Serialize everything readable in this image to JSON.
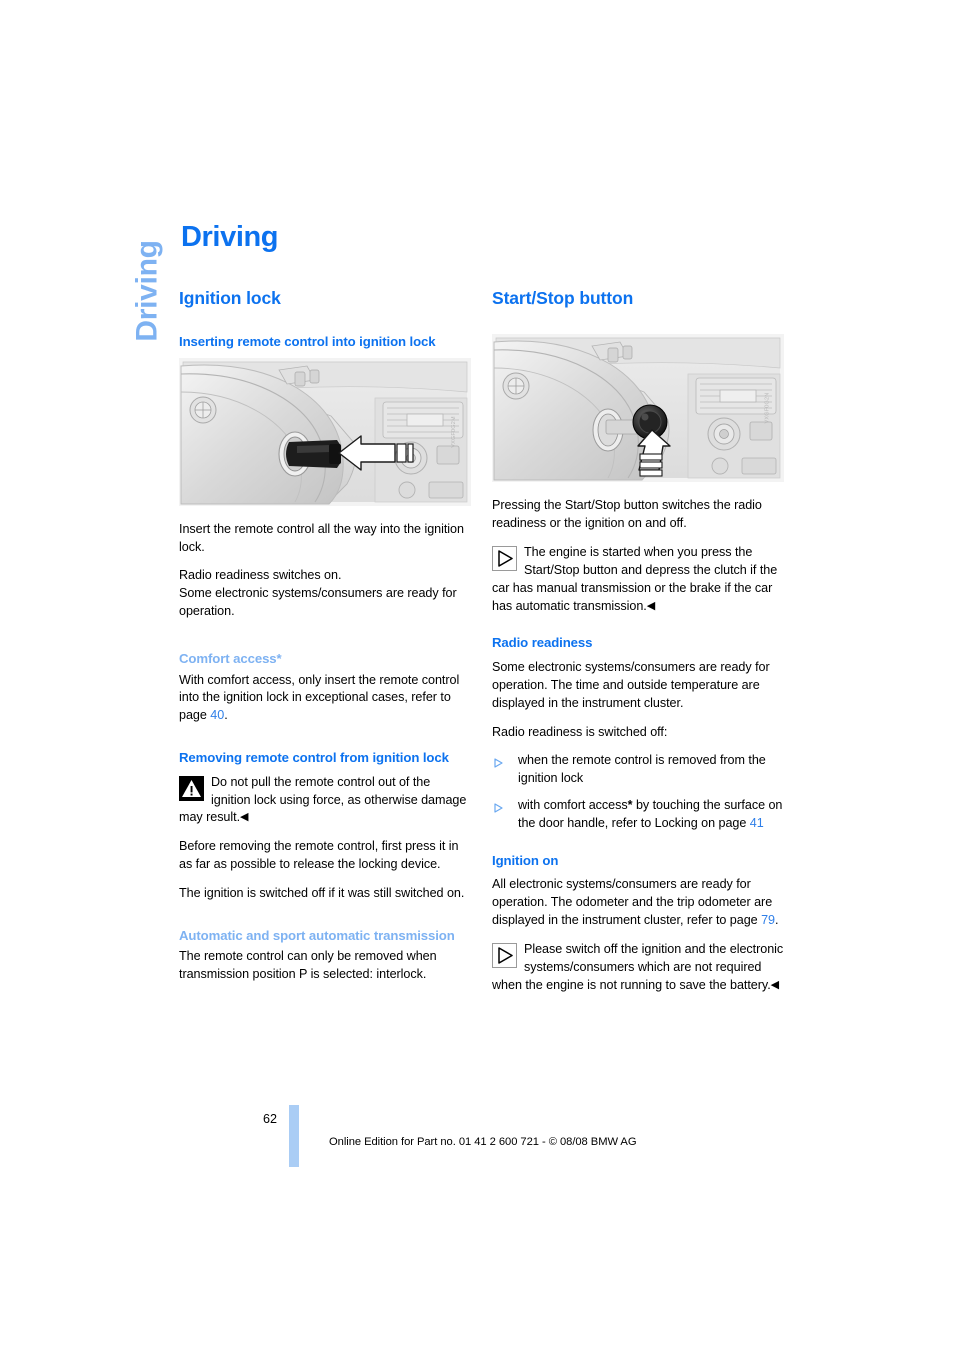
{
  "chapter_tab": {
    "label": "Driving"
  },
  "page_title": "Driving",
  "left_column": {
    "section_heading": "Ignition lock",
    "sub1_heading": "Inserting remote control into ignition lock",
    "figure1": {
      "code": "VXGF0G2M",
      "alt": "Dashboard view showing remote control being inserted into the ignition lock with a white arrow"
    },
    "para1": "Insert the remote control all the way into the ignition lock.",
    "para2_line1": "Radio readiness switches on.",
    "para2_line2": "Some electronic systems/consumers are ready for operation.",
    "comfort_heading": "Comfort access*",
    "comfort_text_a": "With comfort access, only insert the remote control into the ignition lock in exceptional cases, refer to page ",
    "comfort_page_ref": "40",
    "comfort_text_b": ".",
    "removing_heading": "Removing remote control from ignition lock",
    "warning_icon": "warning-triangle-icon",
    "warning_text": "Do not pull the remote control out of the ignition lock using force, as otherwise damage may result.",
    "warning_end_mark": "◀",
    "para3": "Before removing the remote control, first press it in as far as possible to release the locking device.",
    "para4": "The ignition is switched off if it was still switched on.",
    "auto_heading": "Automatic and sport automatic transmission",
    "auto_text": "The remote control can only be removed when transmission position P is selected: interlock."
  },
  "right_column": {
    "section_heading": "Start/Stop button",
    "figure2": {
      "code": "VXGF0G2N",
      "alt": "Dashboard view showing the Start/Stop button with a white arrow pointing at it"
    },
    "para1": "Pressing the Start/Stop button switches the radio readiness or the ignition on and off.",
    "note_icon": "note-triangle-icon",
    "note_text": "The engine is started when you press the Start/Stop button and depress the clutch if the car has manual transmission or the brake if the car has automatic transmission.",
    "note_end_mark": "◀",
    "radio_heading": "Radio readiness",
    "radio_para1": "Some electronic systems/consumers are ready for operation. The time and outside temperature are displayed in the instrument cluster.",
    "radio_para2": "Radio readiness is switched off:",
    "bullets": [
      {
        "text": "when the remote control is removed from the ignition lock"
      },
      {
        "text_a": "with comfort access",
        "star": "*",
        "text_b": " by touching the surface on the door handle, refer to Locking on page ",
        "page_ref": "41"
      }
    ],
    "ignition_heading": "Ignition on",
    "ignition_para_a": "All electronic systems/consumers are ready for operation. The odometer and the trip odometer are displayed in the instrument cluster, refer to page ",
    "ignition_page_ref": "79",
    "ignition_para_b": ".",
    "note2_icon": "note-triangle-icon",
    "note2_text": "Please switch off the ignition and the electronic systems/consumers which are not required when the engine is not running to save the battery.",
    "note2_end_mark": "◀"
  },
  "footer": {
    "page_number": "62",
    "imprint": "Online Edition for Part no. 01 41 2 600 721 - © 08/08 BMW AG"
  },
  "colors": {
    "heading_blue": "#0c72ef",
    "light_blue": "#7eb2f2",
    "page_ref_blue": "#2f7fe8",
    "page_bar_blue": "#aacdf5"
  }
}
